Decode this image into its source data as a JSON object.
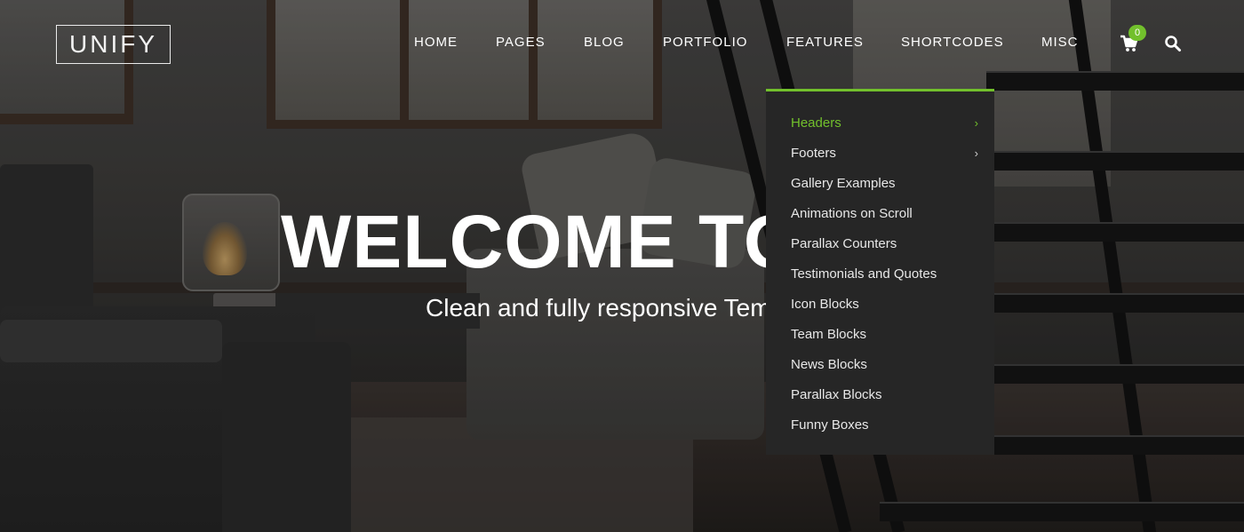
{
  "brand": {
    "logo_text": "UNIFY"
  },
  "nav": {
    "items": [
      {
        "label": "HOME"
      },
      {
        "label": "PAGES"
      },
      {
        "label": "BLOG"
      },
      {
        "label": "PORTFOLIO"
      },
      {
        "label": "FEATURES"
      },
      {
        "label": "SHORTCODES"
      },
      {
        "label": "MISC"
      }
    ],
    "cart_icon": "shopping-cart-icon",
    "cart_count": "0",
    "search_icon": "search-icon"
  },
  "hero": {
    "title": "WELCOME TO U",
    "subtitle": "Clean and fully responsive Temp"
  },
  "dropdown": {
    "items": [
      {
        "label": "Headers",
        "submenu": true,
        "active": true
      },
      {
        "label": "Footers",
        "submenu": true
      },
      {
        "label": "Gallery Examples"
      },
      {
        "label": "Animations on Scroll"
      },
      {
        "label": "Parallax Counters"
      },
      {
        "label": "Testimonials and Quotes"
      },
      {
        "label": "Icon Blocks"
      },
      {
        "label": "Team Blocks"
      },
      {
        "label": "News Blocks"
      },
      {
        "label": "Parallax Blocks"
      },
      {
        "label": "Funny Boxes"
      }
    ],
    "chevron": "›"
  },
  "colors": {
    "accent": "#72c02c",
    "dropdown_bg": "#262626",
    "text": "#ffffff"
  }
}
